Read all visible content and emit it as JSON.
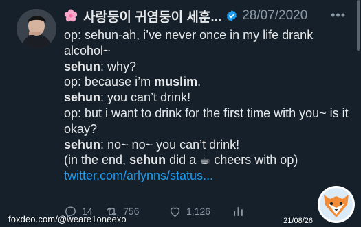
{
  "tweet": {
    "author_name": "사랑둥이 귀염둥이 세훈...",
    "date": "28/07/2020",
    "lines": {
      "l1": "op: sehun-ah, i’ve never once in my life drank alcohol~",
      "l2_name": "sehun",
      "l2_text": ": why?",
      "l3_prefix": "op: because i’m ",
      "l3_bold": "muslim",
      "l3_suffix": ".",
      "l4_name": "sehun",
      "l4_text": ": you can’t drink!",
      "l5": "op: but i want to drink for the first time with you~ is it okay?",
      "l6_name": "sehun",
      "l6_text": ": no~ no~ you can’t drink!",
      "l7_prefix": "(in the end, ",
      "l7_name": "sehun",
      "l7_mid": " did a ",
      "l7_emoji": "☕",
      "l7_suffix": " cheers with op)"
    },
    "link": "twitter.com/arlynns/status..."
  },
  "actions": {
    "replies": "14",
    "retweets": "756",
    "likes": "1,126"
  },
  "watermark": {
    "left": "foxdeo.com/@weare1oneexo",
    "right": "21/08/26"
  },
  "icons": {
    "flower": "cherry-blossom-icon",
    "verified": "verified-badge-icon",
    "more": "more-options-icon",
    "reply": "reply-icon",
    "retweet": "retweet-icon",
    "like": "heart-icon",
    "views": "analytics-icon"
  },
  "colors": {
    "background": "#15202b",
    "text": "#e7e9ea",
    "muted": "#8b98a5",
    "link": "#1d9bf0"
  }
}
